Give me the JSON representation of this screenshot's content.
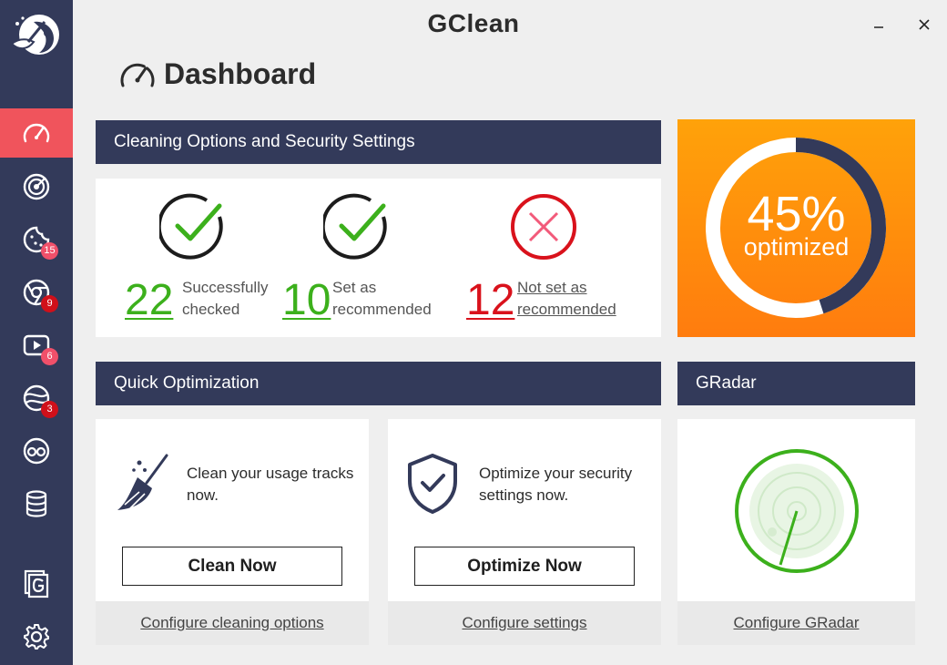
{
  "app": {
    "title": "GClean"
  },
  "page": {
    "title": "Dashboard"
  },
  "sidebar": {
    "items": [
      {
        "name": "dashboard",
        "active": true
      },
      {
        "name": "radar"
      },
      {
        "name": "cookies",
        "badge": "15"
      },
      {
        "name": "browser",
        "badge": "9"
      },
      {
        "name": "youtube",
        "badge": "6"
      },
      {
        "name": "network",
        "badge": "3"
      },
      {
        "name": "spy"
      },
      {
        "name": "database"
      },
      {
        "name": "gdata"
      },
      {
        "name": "settings"
      }
    ]
  },
  "cleaning": {
    "header": "Cleaning Options and Security Settings",
    "checked": {
      "value": "22",
      "label_line1": "Successfully",
      "label_line2": "checked"
    },
    "recommended": {
      "value": "10",
      "label_line1": "Set as",
      "label_line2": "recommended"
    },
    "not_recommended": {
      "value": "12",
      "label_line1": "Not set as",
      "label_line2": "recommended"
    }
  },
  "gauge": {
    "percent_text": "45%",
    "percent": 45,
    "label": "optimized"
  },
  "quick": {
    "header": "Quick Optimization",
    "clean": {
      "text_line1": "Clean your usage tracks",
      "text_line2": "now.",
      "button": "Clean Now",
      "link": "Configure cleaning options"
    },
    "optimize": {
      "text_line1": "Optimize your security",
      "text_line2": "settings now.",
      "button": "Optimize Now",
      "link": "Configure settings"
    }
  },
  "gradar": {
    "header": "GRadar",
    "link": "Configure GRadar"
  },
  "colors": {
    "sidebar": "#333a5a",
    "accent": "#f0545c",
    "green": "#3cb01c",
    "red": "#d9121c",
    "orange": "#ff8a0c"
  }
}
